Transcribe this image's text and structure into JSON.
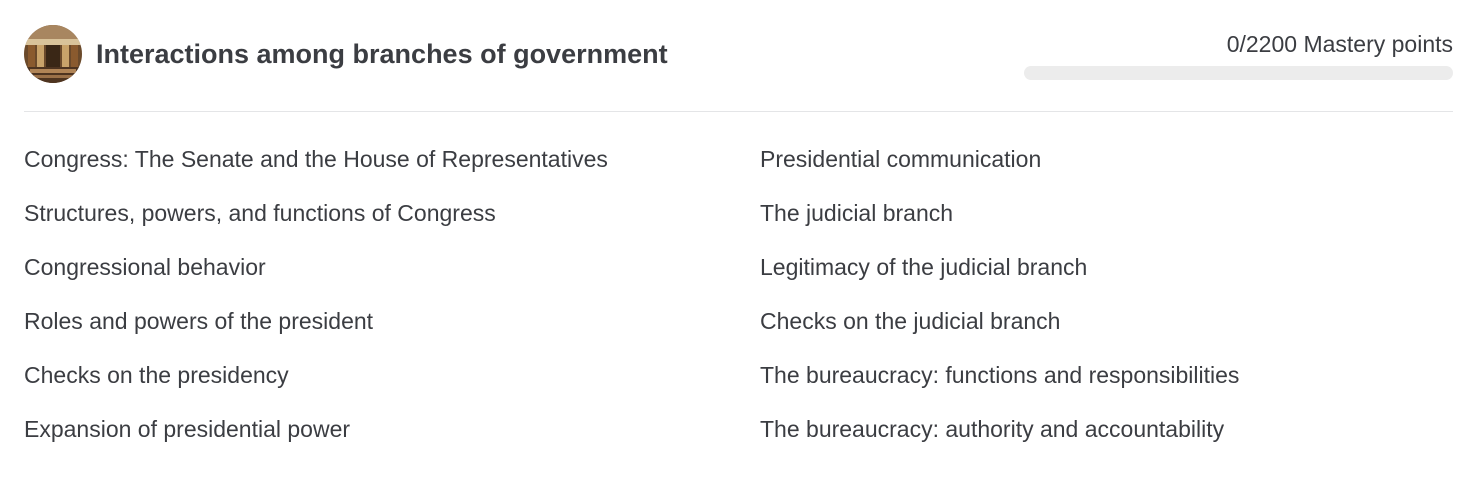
{
  "unit": {
    "title": "Interactions among branches of government",
    "mastery_text": "0/2200 Mastery points",
    "mastery_progress": 0
  },
  "lessons": [
    {
      "label": "Congress: The Senate and the House of Representatives"
    },
    {
      "label": "Structures, powers, and functions of Congress"
    },
    {
      "label": "Congressional behavior"
    },
    {
      "label": "Roles and powers of the president"
    },
    {
      "label": "Checks on the presidency"
    },
    {
      "label": "Expansion of presidential power"
    },
    {
      "label": "Presidential communication"
    },
    {
      "label": "The judicial branch"
    },
    {
      "label": "Legitimacy of the judicial branch"
    },
    {
      "label": "Checks on the judicial branch"
    },
    {
      "label": "The bureaucracy: functions and responsibilities"
    },
    {
      "label": "The bureaucracy: authority and accountability"
    }
  ],
  "colors": {
    "progress_track": "#ececec",
    "progress_fill": "#1865f2",
    "text": "#3b3d42",
    "divider": "#e4e5e7"
  }
}
